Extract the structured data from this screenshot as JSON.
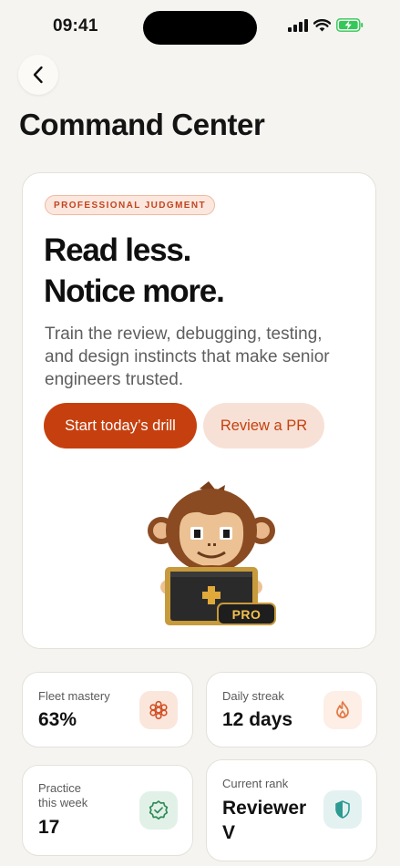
{
  "status_bar": {
    "time": "09:41"
  },
  "header": {
    "title": "Command Center"
  },
  "hero": {
    "tag": "PROFESSIONAL JUDGMENT",
    "headline_line1": "Read less.",
    "headline_line2": "Notice more.",
    "body": "Train the review, debugging, testing, and design instincts that make senior engineers trusted.",
    "primary_button": "Start today’s drill",
    "secondary_button": "Review a PR",
    "badge": "PRO"
  },
  "stats": {
    "fleet_mastery": {
      "label": "Fleet mastery",
      "value": "63%",
      "icon": "hexagon-cluster-icon"
    },
    "daily_streak": {
      "label": "Daily streak",
      "value": "12 days",
      "icon": "flame-icon"
    },
    "practice": {
      "label": "Practice this week",
      "value": "17",
      "icon": "badge-check-icon"
    },
    "rank": {
      "label": "Current rank",
      "value": "Reviewer V",
      "icon": "shield-icon"
    }
  },
  "colors": {
    "accent": "#c6400f",
    "accent_soft": "#f7e1d6",
    "background": "#f5f4f0",
    "battery": "#34c759"
  }
}
